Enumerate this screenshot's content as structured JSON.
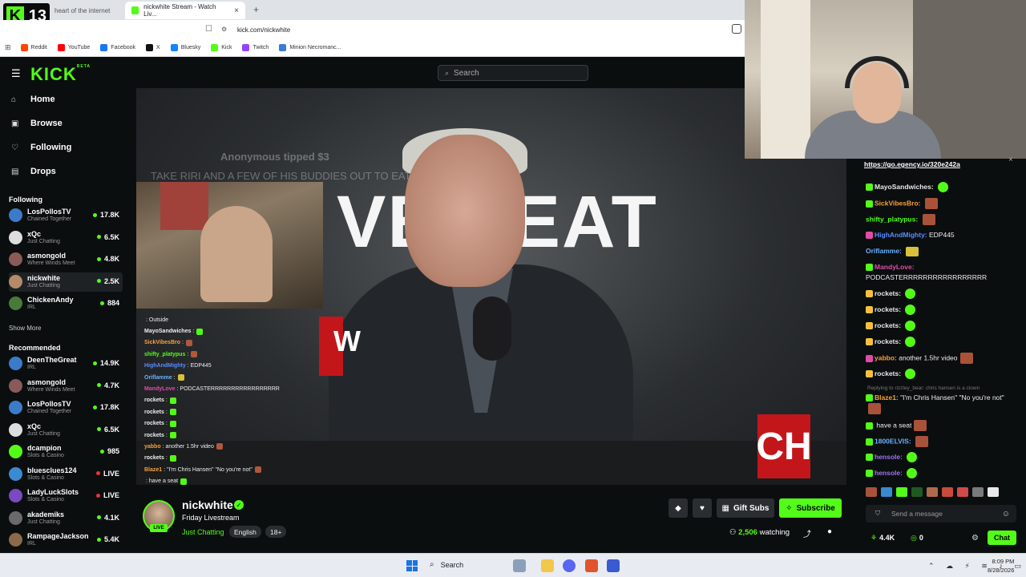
{
  "browser": {
    "tabs": [
      {
        "label": "heart of the internet"
      },
      {
        "label": "nickwhite Stream - Watch Liv..."
      }
    ],
    "close_icon": "×",
    "new_tab_icon": "+",
    "address": "kick.com/nickwhite",
    "bookmarks": [
      {
        "label": "Reddit",
        "color": "#ff4500"
      },
      {
        "label": "YouTube",
        "color": "#ff0000"
      },
      {
        "label": "Facebook",
        "color": "#1877f2"
      },
      {
        "label": "X",
        "color": "#111111"
      },
      {
        "label": "Bluesky",
        "color": "#1185fe"
      },
      {
        "label": "Kick",
        "color": "#53fc18"
      },
      {
        "label": "Twitch",
        "color": "#9146ff"
      },
      {
        "label": "Minion Necromanc...",
        "color": "#3a7bd5"
      }
    ],
    "badge_number": "13",
    "badge_letter": "K"
  },
  "header": {
    "logo": "KICK",
    "logo_sup": "BETA",
    "search_placeholder": "Search"
  },
  "nav": {
    "items": [
      {
        "label": "Home",
        "icon": "home-icon",
        "glyph": "⌂"
      },
      {
        "label": "Browse",
        "icon": "browse-icon",
        "glyph": "▣"
      },
      {
        "label": "Following",
        "icon": "heart-icon",
        "glyph": "♡"
      },
      {
        "label": "Drops",
        "icon": "drops-icon",
        "glyph": "▤"
      }
    ]
  },
  "following": {
    "title": "Following",
    "channels": [
      {
        "name": "LosPollosTV",
        "sub": "Chained Together",
        "viewers": "17.8K",
        "color": "#3c7bc9"
      },
      {
        "name": "xQc",
        "sub": "Just Chatting",
        "viewers": "6.5K",
        "color": "#dddddd"
      },
      {
        "name": "asmongold",
        "sub": "Where Winds Meet",
        "viewers": "4.8K",
        "color": "#8a5a5a"
      },
      {
        "name": "nickwhite",
        "sub": "Just Chatting",
        "viewers": "2.5K",
        "color": "#b58a6a"
      },
      {
        "name": "ChickenAndy",
        "sub": "IRL",
        "viewers": "884",
        "color": "#4a7a3a"
      }
    ],
    "show_more": "Show More"
  },
  "recommended": {
    "title": "Recommended",
    "channels": [
      {
        "name": "DeenTheGreat",
        "sub": "IRL",
        "viewers": "14.9K",
        "color": "#3c7bc9"
      },
      {
        "name": "asmongold",
        "sub": "Where Winds Meet",
        "viewers": "4.7K",
        "color": "#8a5a5a"
      },
      {
        "name": "LosPollosTV",
        "sub": "Chained Together",
        "viewers": "17.8K",
        "color": "#3c7bc9"
      },
      {
        "name": "xQc",
        "sub": "Just Chatting",
        "viewers": "6.5K",
        "color": "#dddddd"
      },
      {
        "name": "dcampion",
        "sub": "Slots & Casino",
        "viewers": "985",
        "color": "#53fc18"
      },
      {
        "name": "bluesclues124",
        "sub": "Slots & Casino",
        "viewers": "LIVE",
        "color": "#3a8ad0"
      },
      {
        "name": "LadyLuckSlots",
        "sub": "Slots & Casino",
        "viewers": "LIVE",
        "color": "#7a4ac0"
      },
      {
        "name": "akademiks",
        "sub": "Just Chatting",
        "viewers": "4.1K",
        "color": "#6a6a6a"
      },
      {
        "name": "RampageJackson",
        "sub": "IRL",
        "viewers": "5.4K",
        "color": "#8a6a4a"
      }
    ]
  },
  "player": {
    "big_text": "VE SEAT",
    "tip_text": "Anonymous tipped $3",
    "tip_message": "TAKE RIRI AND A FEW OF HIS BUDDIES OUT TO EAT... IT WILL BE",
    "red_letter": "W",
    "logo_text": "CH",
    "overlay_chat": [
      {
        "user": "",
        "msg": ": Outside",
        "color": "#d33",
        "emote": ""
      },
      {
        "user": "MayoSandwiches",
        "msg": ": ",
        "color": "#eee",
        "emote": "g"
      },
      {
        "user": "SickVibesBro",
        "msg": ": ",
        "color": "#f9a13a",
        "emote": "r"
      },
      {
        "user": "shifty_platypus",
        "msg": ": ",
        "color": "#53fc18",
        "emote": "r"
      },
      {
        "user": "HighAndMighty",
        "msg": ": EDP445",
        "color": "#5a8cff",
        "emote": ""
      },
      {
        "user": "Oriflamme",
        "msg": ": ",
        "color": "#6ab0ff",
        "emote": "y"
      },
      {
        "user": "MandyLove",
        "msg": ": PODCASTERRRRRRRRRRRRRRRRR",
        "color": "#e24aa8",
        "emote": ""
      },
      {
        "user": "rockets",
        "msg": ": ",
        "color": "#eee",
        "emote": "g"
      },
      {
        "user": "rockets",
        "msg": ": ",
        "color": "#eee",
        "emote": "g"
      },
      {
        "user": "rockets",
        "msg": ": ",
        "color": "#eee",
        "emote": "g"
      },
      {
        "user": "rockets",
        "msg": ": ",
        "color": "#eee",
        "emote": "g"
      },
      {
        "user": "yabbo",
        "msg": ": another 1.5hr video",
        "color": "#f9a13a",
        "emote": "r"
      },
      {
        "user": "rockets",
        "msg": ": ",
        "color": "#eee",
        "emote": "g"
      },
      {
        "user": "Blaze1",
        "msg": ": \"I'm Chris Hansen\" \"No you're not\"",
        "color": "#f9a13a",
        "emote": "r"
      },
      {
        "user": "",
        "msg": ": have a seat",
        "color": "#d33",
        "emote": "g"
      }
    ]
  },
  "chat": {
    "pinned_link": "https://go.egency.io/320e242a",
    "messages": [
      {
        "user": "MayoSandwiches:",
        "msg": "",
        "color": "#e8e8e8",
        "emote": "g",
        "badge": "#53fc18"
      },
      {
        "user": "SickVibesBro:",
        "msg": "",
        "color": "#f9a13a",
        "emote": "r",
        "badge": "#53fc18"
      },
      {
        "user": "shifty_platypus:",
        "msg": "",
        "color": "#53fc18",
        "emote": "r",
        "badge": ""
      },
      {
        "user": "HighAndMighty:",
        "msg": "EDP445",
        "color": "#5a8cff",
        "emote": "",
        "badge": "#e24aa8"
      },
      {
        "user": "Oriflamme:",
        "msg": "",
        "color": "#6ab0ff",
        "emote": "y",
        "badge": ""
      },
      {
        "user": "MandyLove:",
        "msg": "PODCASTERRRRRRRRRRRRRRRRR",
        "color": "#e24aa8",
        "emote": "",
        "badge": "#53fc18"
      },
      {
        "user": "rockets:",
        "msg": "",
        "color": "#e8e8e8",
        "emote": "g",
        "badge": "#f9c23a"
      },
      {
        "user": "rockets:",
        "msg": "",
        "color": "#e8e8e8",
        "emote": "g",
        "badge": "#f9c23a"
      },
      {
        "user": "rockets:",
        "msg": "",
        "color": "#e8e8e8",
        "emote": "g",
        "badge": "#f9c23a"
      },
      {
        "user": "rockets:",
        "msg": "",
        "color": "#e8e8e8",
        "emote": "g",
        "badge": "#f9c23a"
      },
      {
        "user": "yabbo:",
        "msg": "another 1.5hr video",
        "color": "#f9a13a",
        "emote": "r",
        "badge": "#e24aa8"
      },
      {
        "user": "rockets:",
        "msg": "",
        "color": "#e8e8e8",
        "emote": "g",
        "badge": "#f9c23a"
      }
    ],
    "reply_context": "Replying to rizzley_bear: chris hansen is a clown",
    "reply_messages": [
      {
        "user": "Blaze1:",
        "msg": "\"I'm Chris Hansen\" \"No you're not\"",
        "color": "#f9a13a",
        "emote": "r",
        "badge": "#53fc18"
      },
      {
        "user": "",
        "msg": "have a seat",
        "color": "#d33",
        "emote": "r",
        "badge": "#53fc18"
      },
      {
        "user": "1800ELVIS:",
        "msg": "",
        "color": "#6ab0ff",
        "emote": "r",
        "badge": "#53fc18"
      },
      {
        "user": "hensole:",
        "msg": "",
        "color": "#a070ff",
        "emote": "g",
        "badge": "#53fc18"
      },
      {
        "user": "hensole:",
        "msg": "",
        "color": "#a070ff",
        "emote": "g",
        "badge": "#53fc18"
      }
    ],
    "input_placeholder": "Send a message",
    "points": "4.4K",
    "points2": "0",
    "chat_button": "Chat"
  },
  "stream": {
    "channel": "nickwhite",
    "title": "Friday Livestream",
    "category": "Just Chatting",
    "tags": [
      "English",
      "18+"
    ],
    "live_label": "LIVE",
    "gift_label": "Gift Subs",
    "subscribe_label": "Subscribe",
    "viewers": "2,506",
    "viewers_suffix": "watching"
  },
  "taskbar": {
    "search": "Search",
    "time": "8:09 PM",
    "date": "8/28/2026"
  }
}
